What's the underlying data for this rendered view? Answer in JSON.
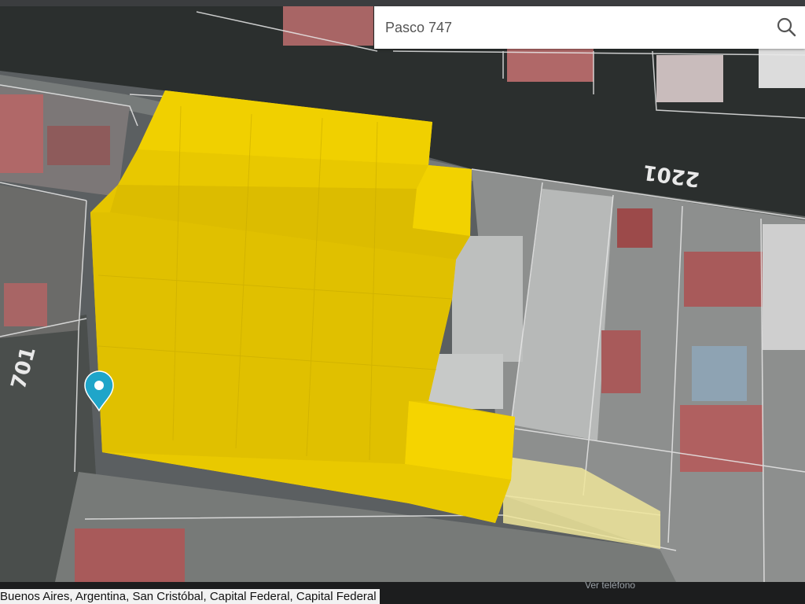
{
  "search": {
    "value": "Pasco 747",
    "icon": "search-icon"
  },
  "map": {
    "street_number_top": "2201",
    "street_number_left": "701",
    "marker_icon": "location-pin-icon",
    "marker_color": "#1fa5c9",
    "highlight_color": "#f5d000",
    "adjacent_highlight_color": "#efe59a"
  },
  "footer": {
    "location": "Buenos Aires, Argentina, San Cristóbal, Capital Federal, Capital Federal",
    "phone_link": "Ver teléfono"
  }
}
